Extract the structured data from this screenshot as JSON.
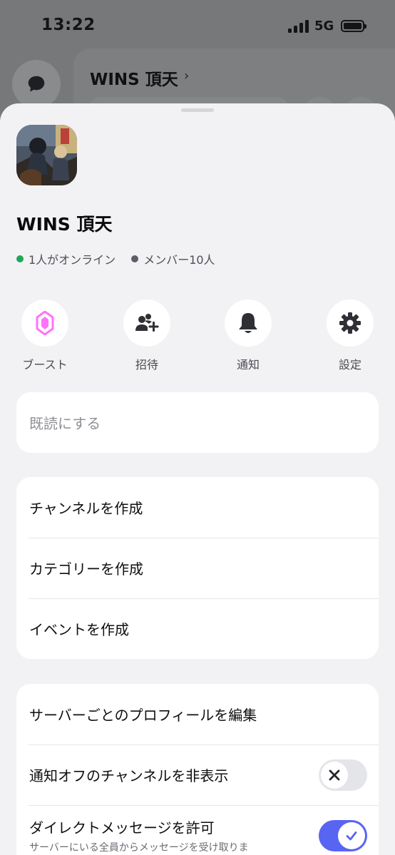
{
  "status_bar": {
    "time": "13:22",
    "network": "5G"
  },
  "background": {
    "server_title": "WINS 頂天"
  },
  "server": {
    "name": "WINS 頂天",
    "online": "1人がオンライン",
    "members": "メンバー10人"
  },
  "actions": [
    {
      "label": "ブースト",
      "icon": "boost-icon"
    },
    {
      "label": "招待",
      "icon": "invite-icon"
    },
    {
      "label": "通知",
      "icon": "bell-icon"
    },
    {
      "label": "設定",
      "icon": "gear-icon"
    }
  ],
  "mark_read": "既読にする",
  "create_menu": [
    "チャンネルを作成",
    "カテゴリーを作成",
    "イベントを作成"
  ],
  "settings_menu": {
    "edit_profile": "サーバーごとのプロフィールを編集",
    "hide_muted": {
      "label": "通知オフのチャンネルを非表示",
      "enabled": false
    },
    "allow_dm": {
      "label": "ダイレクトメッセージを許可",
      "description": "サーバーにいる全員からメッセージを受け取りま",
      "enabled": true
    }
  },
  "colors": {
    "online": "#23a55a",
    "accent": "#5865f2",
    "boost": "#ff73fa"
  }
}
